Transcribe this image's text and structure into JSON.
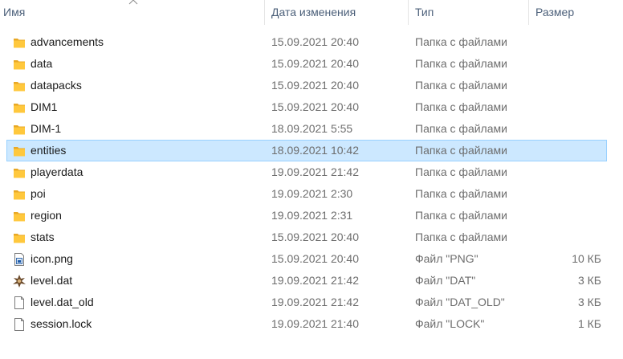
{
  "columns": {
    "name": "Имя",
    "date": "Дата изменения",
    "type": "Тип",
    "size": "Размер"
  },
  "files": [
    {
      "name": "advancements",
      "date": "15.09.2021 20:40",
      "type": "Папка с файлами",
      "size": "",
      "icon": "folder-icon"
    },
    {
      "name": "data",
      "date": "15.09.2021 20:40",
      "type": "Папка с файлами",
      "size": "",
      "icon": "folder-icon"
    },
    {
      "name": "datapacks",
      "date": "15.09.2021 20:40",
      "type": "Папка с файлами",
      "size": "",
      "icon": "folder-icon"
    },
    {
      "name": "DIM1",
      "date": "15.09.2021 20:40",
      "type": "Папка с файлами",
      "size": "",
      "icon": "folder-icon"
    },
    {
      "name": "DIM-1",
      "date": "18.09.2021 5:55",
      "type": "Папка с файлами",
      "size": "",
      "icon": "folder-icon"
    },
    {
      "name": "entities",
      "date": "18.09.2021 10:42",
      "type": "Папка с файлами",
      "size": "",
      "icon": "folder-icon",
      "selected": true
    },
    {
      "name": "playerdata",
      "date": "19.09.2021 21:42",
      "type": "Папка с файлами",
      "size": "",
      "icon": "folder-icon"
    },
    {
      "name": "poi",
      "date": "19.09.2021 2:30",
      "type": "Папка с файлами",
      "size": "",
      "icon": "folder-icon"
    },
    {
      "name": "region",
      "date": "19.09.2021 2:31",
      "type": "Папка с файлами",
      "size": "",
      "icon": "folder-icon"
    },
    {
      "name": "stats",
      "date": "15.09.2021 20:40",
      "type": "Папка с файлами",
      "size": "",
      "icon": "folder-icon"
    },
    {
      "name": "icon.png",
      "date": "15.09.2021 20:40",
      "type": "Файл \"PNG\"",
      "size": "10 КБ",
      "icon": "image-file-icon"
    },
    {
      "name": "level.dat",
      "date": "19.09.2021 21:42",
      "type": "Файл \"DAT\"",
      "size": "3 КБ",
      "icon": "dat-file-icon"
    },
    {
      "name": "level.dat_old",
      "date": "19.09.2021 21:42",
      "type": "Файл \"DAT_OLD\"",
      "size": "3 КБ",
      "icon": "blank-file-icon"
    },
    {
      "name": "session.lock",
      "date": "19.09.2021 21:40",
      "type": "Файл \"LOCK\"",
      "size": "1 КБ",
      "icon": "blank-file-icon"
    }
  ],
  "colors": {
    "selection_bg": "#cce8ff",
    "selection_border": "#99d1ff",
    "header_text": "#4c607a",
    "secondary_text": "#6d6d6d",
    "folder": "#ffc83d"
  }
}
